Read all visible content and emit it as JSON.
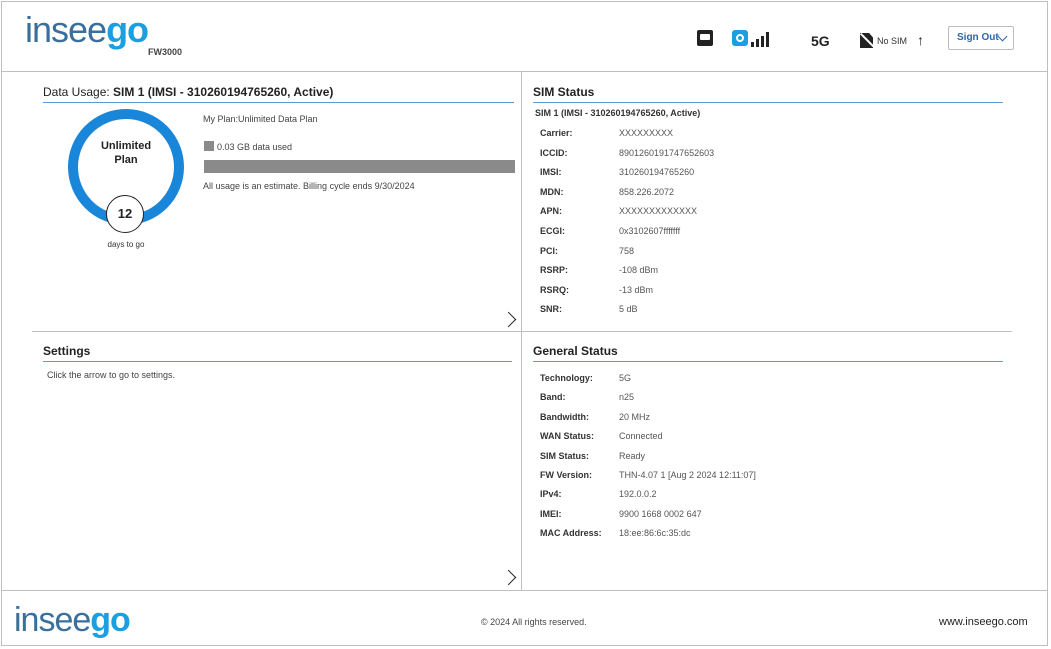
{
  "header": {
    "logo_left": "insee",
    "logo_right": "go",
    "model": "FW3000",
    "network_type": "5G",
    "sim_status": "No SIM",
    "sign_out_label": "Sign Out",
    "signal_bars": 4,
    "icons": [
      "ethernet-icon",
      "wifi-icon",
      "signal-bars-icon",
      "no-sim-icon",
      "upload-arrow-icon",
      "chevron-down-icon"
    ]
  },
  "data_usage": {
    "title_prefix": "Data Usage:",
    "title_sim": "SIM 1 (IMSI - 310260194765260, Active)",
    "gauge_line1": "Unlimited",
    "gauge_line2": "Plan",
    "days_remaining": "12",
    "days_label": "days to go",
    "plan_label": "My Plan:Unlimited Data Plan",
    "data_used": "0.03 GB data used",
    "usage_fraction": 0.0,
    "note": "All usage is an estimate. Billing cycle ends 9/30/2024"
  },
  "settings": {
    "title": "Settings",
    "text": "Click the arrow to go to settings."
  },
  "sim_status": {
    "title": "SIM Status",
    "subtitle": "SIM 1 (IMSI - 310260194765260, Active)",
    "rows": [
      {
        "label": "Carrier:",
        "value": "XXXXXXXXX"
      },
      {
        "label": "ICCID:",
        "value": "8901260191747652603"
      },
      {
        "label": "IMSI:",
        "value": "310260194765260"
      },
      {
        "label": "MDN:",
        "value": "858.226.2072"
      },
      {
        "label": "APN:",
        "value": "XXXXXXXXXXXXX"
      },
      {
        "label": "ECGI:",
        "value": "0x3102607fffffff"
      },
      {
        "label": "PCI:",
        "value": "758"
      },
      {
        "label": "RSRP:",
        "value": "-108 dBm"
      },
      {
        "label": "RSRQ:",
        "value": "-13 dBm"
      },
      {
        "label": "SNR:",
        "value": "5 dB"
      }
    ]
  },
  "general_status": {
    "title": "General Status",
    "rows": [
      {
        "label": "Technology:",
        "value": "5G"
      },
      {
        "label": "Band:",
        "value": "n25"
      },
      {
        "label": "Bandwidth:",
        "value": "20 MHz"
      },
      {
        "label": "WAN Status:",
        "value": "Connected"
      },
      {
        "label": "SIM Status:",
        "value": "Ready"
      },
      {
        "label": "FW Version:",
        "value": "THN-4.07 1 [Aug 2 2024 12:11:07]"
      },
      {
        "label": "IPv4:",
        "value": "192.0.0.2"
      },
      {
        "label": "IMEI:",
        "value": "9900 1668 0002 647"
      },
      {
        "label": "MAC Address:",
        "value": "18:ee:86:6c:35:dc"
      }
    ]
  },
  "footer": {
    "logo_left": "insee",
    "logo_right": "go",
    "copyright": "© 2024 All rights reserved.",
    "website": "www.inseego.com"
  },
  "colors": {
    "accent": "#1a86d9",
    "brand_dark": "#3a6f9c",
    "brand_light": "#1aa0e0",
    "rule": "#5b9bd5"
  }
}
